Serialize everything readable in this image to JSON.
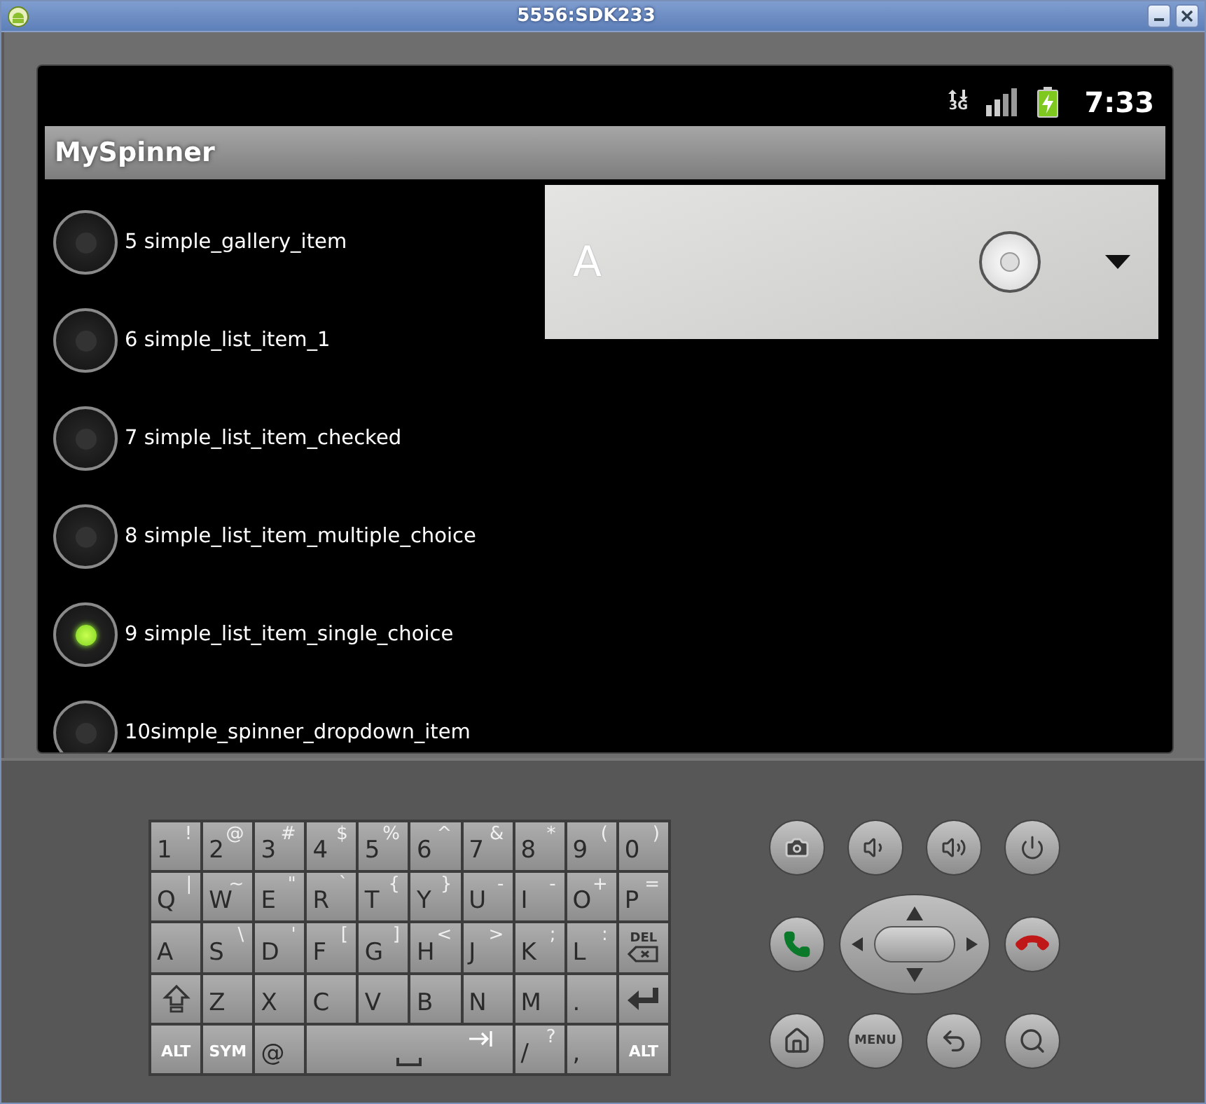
{
  "window": {
    "title": "5556:SDK233"
  },
  "status_bar": {
    "network": "3G",
    "time": "7:33"
  },
  "app_bar": {
    "title": "MySpinner"
  },
  "options": [
    {
      "label": "5 simple_gallery_item",
      "selected": false
    },
    {
      "label": "6 simple_list_item_1",
      "selected": false
    },
    {
      "label": "7 simple_list_item_checked",
      "selected": false
    },
    {
      "label": "8 simple_list_item_multiple_choice",
      "selected": false
    },
    {
      "label": "9 simple_list_item_single_choice",
      "selected": true
    },
    {
      "label": "10simple_spinner_dropdown_item",
      "selected": false
    }
  ],
  "spinner": {
    "value": "A"
  },
  "keyboard": {
    "keys": [
      {
        "kind": "char",
        "main": "1",
        "alt": "!"
      },
      {
        "kind": "char",
        "main": "2",
        "alt": "@"
      },
      {
        "kind": "char",
        "main": "3",
        "alt": "#"
      },
      {
        "kind": "char",
        "main": "4",
        "alt": "$"
      },
      {
        "kind": "char",
        "main": "5",
        "alt": "%"
      },
      {
        "kind": "char",
        "main": "6",
        "alt": "^"
      },
      {
        "kind": "char",
        "main": "7",
        "alt": "&"
      },
      {
        "kind": "char",
        "main": "8",
        "alt": "*"
      },
      {
        "kind": "char",
        "main": "9",
        "alt": "("
      },
      {
        "kind": "char",
        "main": "0",
        "alt": ")"
      },
      {
        "kind": "char",
        "main": "Q",
        "alt": "|"
      },
      {
        "kind": "char",
        "main": "W",
        "alt": "~"
      },
      {
        "kind": "char",
        "main": "E",
        "alt": "\""
      },
      {
        "kind": "char",
        "main": "R",
        "alt": "`"
      },
      {
        "kind": "char",
        "main": "T",
        "alt": "{"
      },
      {
        "kind": "char",
        "main": "Y",
        "alt": "}"
      },
      {
        "kind": "char",
        "main": "U",
        "alt": "-"
      },
      {
        "kind": "char",
        "main": "I",
        "alt": "-"
      },
      {
        "kind": "char",
        "main": "O",
        "alt": "+"
      },
      {
        "kind": "char",
        "main": "P",
        "alt": "="
      },
      {
        "kind": "char",
        "main": "A"
      },
      {
        "kind": "char",
        "main": "S",
        "alt": "\\"
      },
      {
        "kind": "char",
        "main": "D",
        "alt": "'"
      },
      {
        "kind": "char",
        "main": "F",
        "alt": "["
      },
      {
        "kind": "char",
        "main": "G",
        "alt": "]"
      },
      {
        "kind": "char",
        "main": "H",
        "alt": "<"
      },
      {
        "kind": "char",
        "main": "J",
        "alt": ">"
      },
      {
        "kind": "char",
        "main": "K",
        "alt": ";"
      },
      {
        "kind": "char",
        "main": "L",
        "alt": ":"
      },
      {
        "kind": "del",
        "main": "DEL"
      },
      {
        "kind": "shift"
      },
      {
        "kind": "char",
        "main": "Z"
      },
      {
        "kind": "char",
        "main": "X"
      },
      {
        "kind": "char",
        "main": "C"
      },
      {
        "kind": "char",
        "main": "V"
      },
      {
        "kind": "char",
        "main": "B"
      },
      {
        "kind": "char",
        "main": "N"
      },
      {
        "kind": "char",
        "main": "M"
      },
      {
        "kind": "char",
        "main": "."
      },
      {
        "kind": "enter"
      },
      {
        "kind": "mod",
        "main": "ALT"
      },
      {
        "kind": "mod",
        "main": "SYM"
      },
      {
        "kind": "char",
        "main": "@"
      },
      {
        "kind": "space"
      },
      {
        "kind": "char",
        "main": "/",
        "alt": "?"
      },
      {
        "kind": "char",
        "main": ","
      },
      {
        "kind": "mod",
        "main": "ALT"
      }
    ]
  },
  "hardware": {
    "menu_label": "MENU"
  }
}
